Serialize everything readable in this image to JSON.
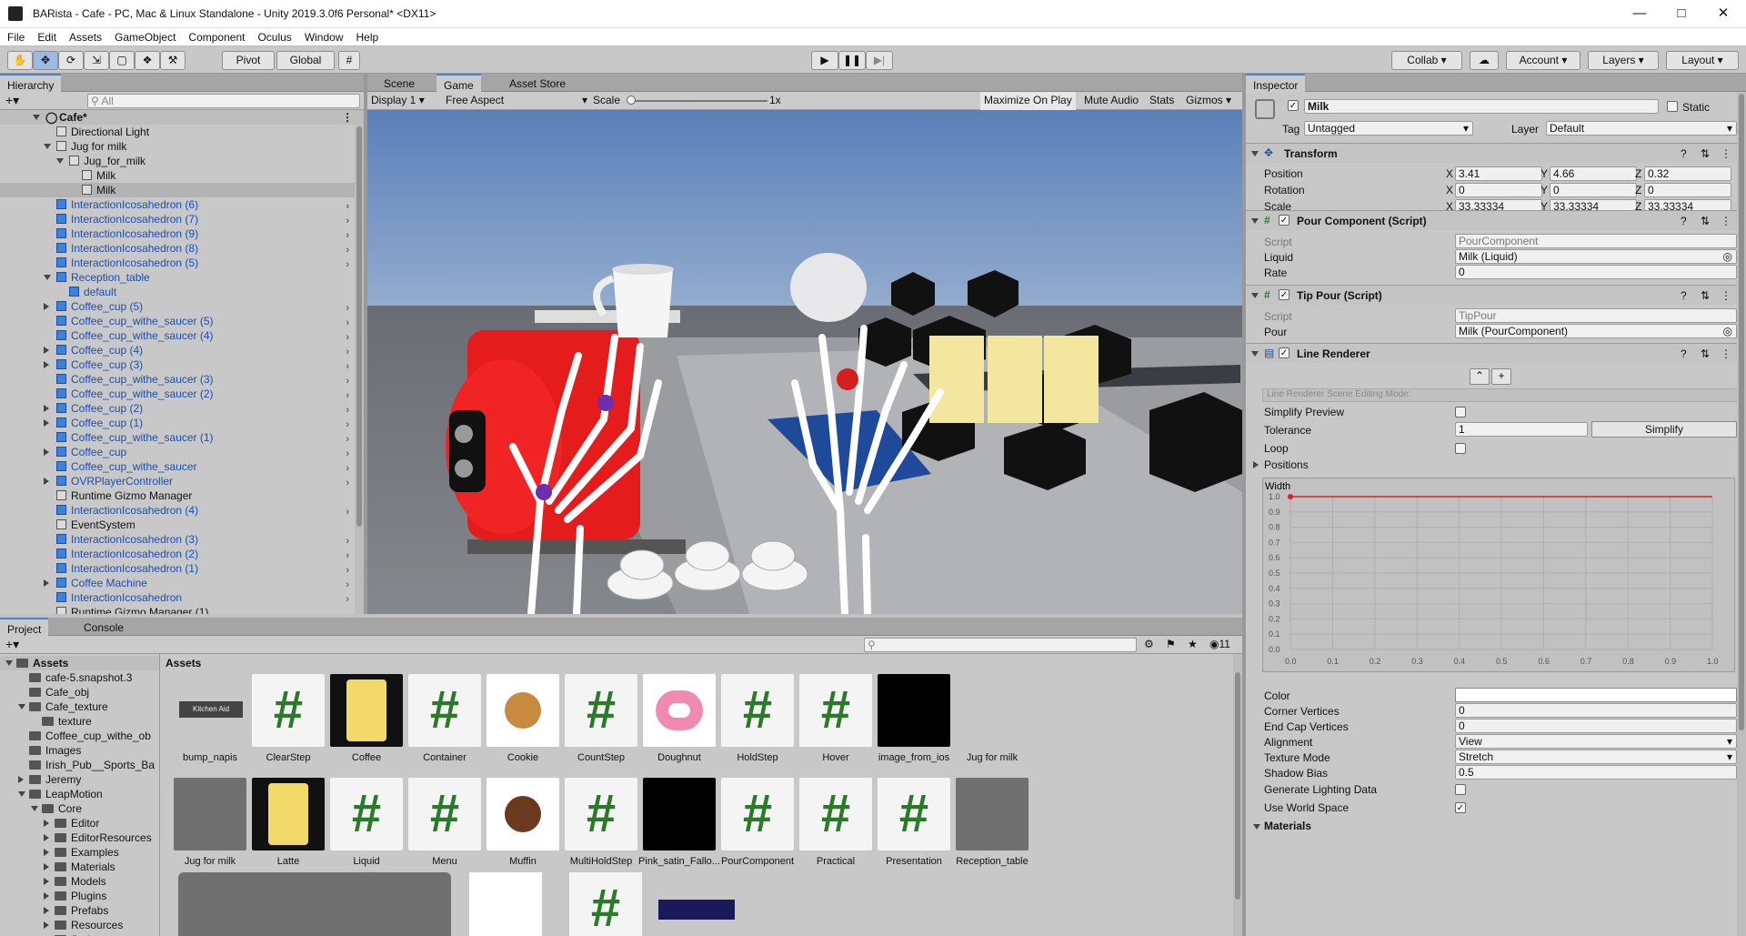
{
  "window": {
    "title": "BARista - Cafe - PC, Mac & Linux Standalone - Unity 2019.3.0f6 Personal* <DX11>"
  },
  "menu": [
    "File",
    "Edit",
    "Assets",
    "GameObject",
    "Component",
    "Oculus",
    "Window",
    "Help"
  ],
  "toolbar": {
    "pivot": "Pivot",
    "global": "Global",
    "collab": "Collab",
    "account": "Account",
    "layers": "Layers",
    "layout": "Layout"
  },
  "hierarchy": {
    "tab": "Hierarchy",
    "search_placeholder": "All",
    "root": "Cafe*",
    "items": [
      {
        "label": "Directional Light",
        "indent": 1,
        "blue": false,
        "fold": ""
      },
      {
        "label": "Jug for milk",
        "indent": 1,
        "blue": false,
        "fold": "open"
      },
      {
        "label": "Jug_for_milk",
        "indent": 2,
        "blue": false,
        "fold": "open"
      },
      {
        "label": "Milk",
        "indent": 3,
        "blue": false,
        "fold": ""
      },
      {
        "label": "Milk",
        "indent": 3,
        "blue": false,
        "fold": "",
        "selected": true
      },
      {
        "label": "InteractionIcosahedron (6)",
        "indent": 1,
        "blue": true,
        "fold": "",
        "chev": true
      },
      {
        "label": "InteractionIcosahedron (7)",
        "indent": 1,
        "blue": true,
        "fold": "",
        "chev": true
      },
      {
        "label": "InteractionIcosahedron (9)",
        "indent": 1,
        "blue": true,
        "fold": "",
        "chev": true
      },
      {
        "label": "InteractionIcosahedron (8)",
        "indent": 1,
        "blue": true,
        "fold": "",
        "chev": true
      },
      {
        "label": "InteractionIcosahedron (5)",
        "indent": 1,
        "blue": true,
        "fold": "",
        "chev": true
      },
      {
        "label": "Reception_table",
        "indent": 1,
        "blue": true,
        "fold": "open"
      },
      {
        "label": "default",
        "indent": 2,
        "blue": true,
        "fold": ""
      },
      {
        "label": "Coffee_cup (5)",
        "indent": 1,
        "blue": true,
        "fold": "closed",
        "chev": true
      },
      {
        "label": "Coffee_cup_withe_saucer (5)",
        "indent": 1,
        "blue": true,
        "fold": "",
        "chev": true
      },
      {
        "label": "Coffee_cup_withe_saucer (4)",
        "indent": 1,
        "blue": true,
        "fold": "",
        "chev": true
      },
      {
        "label": "Coffee_cup (4)",
        "indent": 1,
        "blue": true,
        "fold": "closed",
        "chev": true
      },
      {
        "label": "Coffee_cup (3)",
        "indent": 1,
        "blue": true,
        "fold": "closed",
        "chev": true
      },
      {
        "label": "Coffee_cup_withe_saucer (3)",
        "indent": 1,
        "blue": true,
        "fold": "",
        "chev": true
      },
      {
        "label": "Coffee_cup_withe_saucer (2)",
        "indent": 1,
        "blue": true,
        "fold": "",
        "chev": true
      },
      {
        "label": "Coffee_cup (2)",
        "indent": 1,
        "blue": true,
        "fold": "closed",
        "chev": true
      },
      {
        "label": "Coffee_cup (1)",
        "indent": 1,
        "blue": true,
        "fold": "closed",
        "chev": true
      },
      {
        "label": "Coffee_cup_withe_saucer (1)",
        "indent": 1,
        "blue": true,
        "fold": "",
        "chev": true
      },
      {
        "label": "Coffee_cup",
        "indent": 1,
        "blue": true,
        "fold": "closed",
        "chev": true
      },
      {
        "label": "Coffee_cup_withe_saucer",
        "indent": 1,
        "blue": true,
        "fold": "",
        "chev": true
      },
      {
        "label": "OVRPlayerController",
        "indent": 1,
        "blue": true,
        "fold": "closed",
        "chev": true
      },
      {
        "label": "Runtime Gizmo Manager",
        "indent": 1,
        "blue": false,
        "fold": ""
      },
      {
        "label": "InteractionIcosahedron (4)",
        "indent": 1,
        "blue": true,
        "fold": "",
        "chev": true
      },
      {
        "label": "EventSystem",
        "indent": 1,
        "blue": false,
        "fold": ""
      },
      {
        "label": "InteractionIcosahedron (3)",
        "indent": 1,
        "blue": true,
        "fold": "",
        "chev": true
      },
      {
        "label": "InteractionIcosahedron (2)",
        "indent": 1,
        "blue": true,
        "fold": "",
        "chev": true
      },
      {
        "label": "InteractionIcosahedron (1)",
        "indent": 1,
        "blue": true,
        "fold": "",
        "chev": true
      },
      {
        "label": "Coffee Machine",
        "indent": 1,
        "blue": true,
        "fold": "closed",
        "chev": true
      },
      {
        "label": "InteractionIcosahedron",
        "indent": 1,
        "blue": true,
        "fold": "",
        "chev": true
      },
      {
        "label": "Runtime Gizmo Manager (1)",
        "indent": 1,
        "blue": false,
        "fold": ""
      }
    ]
  },
  "game": {
    "tabs": [
      "Scene",
      "Game",
      "Asset Store"
    ],
    "display": "Display 1",
    "aspect": "Free Aspect",
    "scale_label": "Scale",
    "scale_value": "1x",
    "buttons": [
      "Maximize On Play",
      "Mute Audio",
      "Stats",
      "Gizmos"
    ]
  },
  "inspector": {
    "tab": "Inspector",
    "object_name": "Milk",
    "static_label": "Static",
    "tag_label": "Tag",
    "tag_value": "Untagged",
    "layer_label": "Layer",
    "layer_value": "Default",
    "transform": {
      "title": "Transform",
      "position": {
        "label": "Position",
        "x": "3.41",
        "y": "4.66",
        "z": "0.32"
      },
      "rotation": {
        "label": "Rotation",
        "x": "0",
        "y": "0",
        "z": "0"
      },
      "scale": {
        "label": "Scale",
        "x": "33.33334",
        "y": "33.33334",
        "z": "33.33334"
      }
    },
    "pour": {
      "title": "Pour Component (Script)",
      "script_label": "Script",
      "script_value": "PourComponent",
      "liquid_label": "Liquid",
      "liquid_value": "Milk (Liquid)",
      "rate_label": "Rate",
      "rate_value": "0"
    },
    "tip": {
      "title": "Tip Pour (Script)",
      "script_label": "Script",
      "script_value": "TipPour",
      "pour_label": "Pour",
      "pour_value": "Milk (PourComponent)"
    },
    "line": {
      "title": "Line Renderer",
      "mode_placeholder": "Line Renderer Scene Editing Mode:",
      "simplify_preview": "Simplify Preview",
      "tolerance": "Tolerance",
      "tolerance_value": "1",
      "simplify_btn": "Simplify",
      "loop": "Loop",
      "positions": "Positions",
      "width_label": "Width",
      "width_value": "1.0",
      "y_ticks": [
        "1.0",
        "0.9",
        "0.8",
        "0.7",
        "0.6",
        "0.5",
        "0.4",
        "0.3",
        "0.2",
        "0.1",
        "0.0"
      ],
      "x_ticks": [
        "0.0",
        "0.1",
        "0.2",
        "0.3",
        "0.4",
        "0.5",
        "0.6",
        "0.7",
        "0.8",
        "0.9",
        "1.0"
      ],
      "color": "Color",
      "corner": "Corner Vertices",
      "corner_value": "0",
      "endcap": "End Cap Vertices",
      "endcap_value": "0",
      "alignment": "Alignment",
      "alignment_value": "View",
      "texture_mode": "Texture Mode",
      "texture_mode_value": "Stretch",
      "shadow_bias": "Shadow Bias",
      "shadow_bias_value": "0.5",
      "gen_lighting": "Generate Lighting Data",
      "world_space": "Use World Space",
      "materials": "Materials"
    }
  },
  "project": {
    "tabs": [
      "Project",
      "Console"
    ],
    "breadcrumb": "Assets",
    "count": "11",
    "tree": [
      {
        "label": "Assets",
        "indent": 0,
        "fold": "open",
        "bold": true
      },
      {
        "label": "cafe-5.snapshot.3",
        "indent": 1,
        "fold": ""
      },
      {
        "label": "Cafe_obj",
        "indent": 1,
        "fold": ""
      },
      {
        "label": "Cafe_texture",
        "indent": 1,
        "fold": "open"
      },
      {
        "label": "texture",
        "indent": 2,
        "fold": ""
      },
      {
        "label": "Coffee_cup_withe_ob",
        "indent": 1,
        "fold": ""
      },
      {
        "label": "Images",
        "indent": 1,
        "fold": ""
      },
      {
        "label": "Irish_Pub__Sports_Ba",
        "indent": 1,
        "fold": ""
      },
      {
        "label": "Jeremy",
        "indent": 1,
        "fold": "closed"
      },
      {
        "label": "LeapMotion",
        "indent": 1,
        "fold": "open"
      },
      {
        "label": "Core",
        "indent": 2,
        "fold": "open"
      },
      {
        "label": "Editor",
        "indent": 3,
        "fold": "closed"
      },
      {
        "label": "EditorResources",
        "indent": 3,
        "fold": "closed"
      },
      {
        "label": "Examples",
        "indent": 3,
        "fold": "closed"
      },
      {
        "label": "Materials",
        "indent": 3,
        "fold": "closed"
      },
      {
        "label": "Models",
        "indent": 3,
        "fold": "closed"
      },
      {
        "label": "Plugins",
        "indent": 3,
        "fold": "closed"
      },
      {
        "label": "Prefabs",
        "indent": 3,
        "fold": "closed"
      },
      {
        "label": "Resources",
        "indent": 3,
        "fold": "closed"
      },
      {
        "label": "Scripts",
        "indent": 3,
        "fold": "closed"
      }
    ],
    "assets_row1": [
      "bump_napis",
      "ClearStep",
      "Coffee",
      "Container",
      "Cookie",
      "CountStep",
      "Doughnut",
      "HoldStep",
      "Hover",
      "image_from_ios",
      "Jug for milk"
    ],
    "assets_row2": [
      "Jug for milk",
      "Latte",
      "Liquid",
      "Menu",
      "Muffin",
      "MultiHoldStep",
      "Pink_satin_Fallo...",
      "PourComponent",
      "Practical",
      "Presentation",
      "Reception_table"
    ],
    "kitchen_aid": "Kitchen Aid"
  }
}
